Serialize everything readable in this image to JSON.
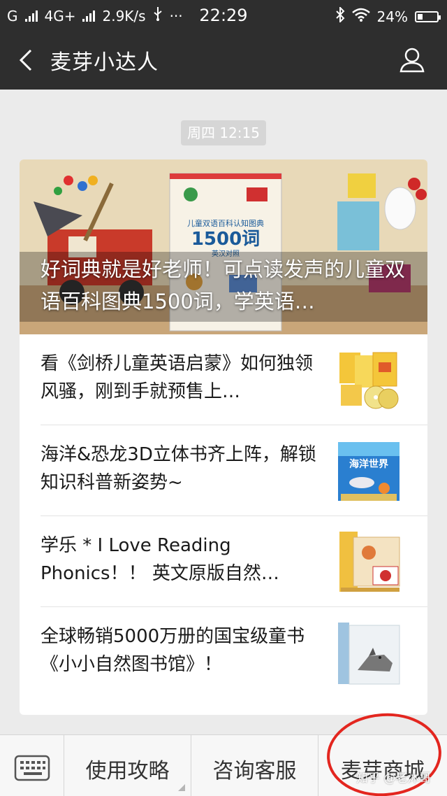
{
  "status_bar": {
    "carrier1": "G",
    "carrier2": "4G+",
    "speed": "2.9K/s",
    "usb_icon": "usb-icon",
    "more": "···",
    "time": "22:29",
    "battery": "24%"
  },
  "nav": {
    "title": "麦芽小达人",
    "back_icon": "chevron-left-icon",
    "profile_icon": "person-icon"
  },
  "timestamp": "周四 12:15",
  "hero": {
    "title": "好词典就是好老师！可点读发声的儿童双语百科图典1500词，学英语…",
    "book_title_small": "儿童双语百科认知图典",
    "book_big": "1500词",
    "book_sub": "英汉对照"
  },
  "articles": [
    {
      "title": "看《剑桥儿童英语启蒙》如何独领风骚，刚到手就预售上…",
      "thumb_icon": "cambridge-books-thumb"
    },
    {
      "title": "海洋&恐龙3D立体书齐上阵，解锁知识科普新姿势~",
      "thumb_icon": "ocean-book-thumb",
      "thumb_text": "海洋世界"
    },
    {
      "title": "学乐 * I Love Reading Phonics！！ 英文原版自然…",
      "thumb_icon": "phonics-box-thumb"
    },
    {
      "title": "全球畅销5000万册的国宝级童书《小小自然图书馆》！",
      "thumb_icon": "nature-library-thumb"
    }
  ],
  "bottom_menu": {
    "keyboard_icon": "keyboard-icon",
    "items": [
      "使用攻略",
      "咨询客服",
      "麦芽商城"
    ]
  },
  "annotation_color": "#e3261f",
  "watermark": "知乎 @老沐哥"
}
